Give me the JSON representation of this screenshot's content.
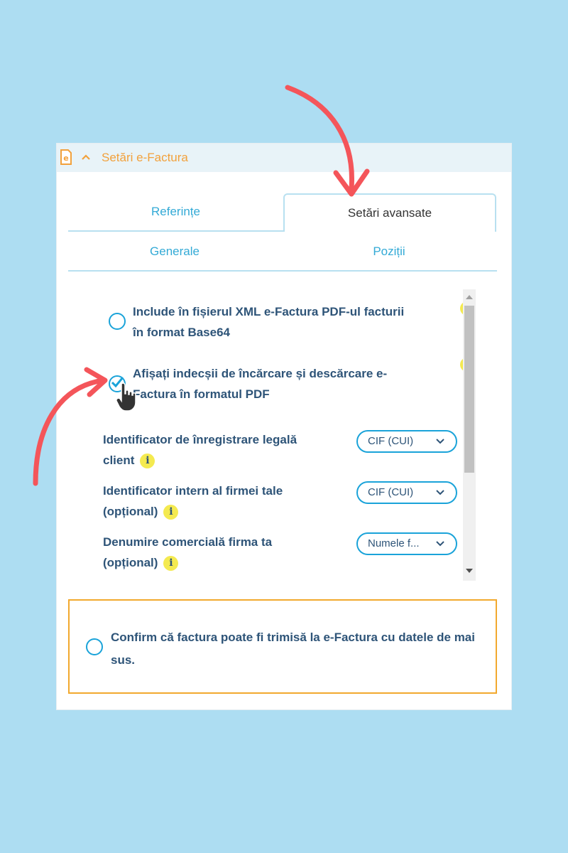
{
  "colors": {
    "background": "#ADDDF2",
    "accent_blue": "#1AA3D9",
    "text_dark_blue": "#2E5478",
    "header_orange": "#F2A13C",
    "confirm_border": "#F2A92E",
    "info_yellow": "#F4EA50",
    "arrow_red": "#F4555A"
  },
  "header": {
    "icon": "document-e-icon",
    "title": "Setări e-Factura"
  },
  "tabs": [
    {
      "label": "Referințe",
      "active": false
    },
    {
      "label": "Setări avansate",
      "active": true
    }
  ],
  "subtabs": [
    {
      "label": "Generale"
    },
    {
      "label": "Poziții"
    }
  ],
  "options": [
    {
      "line1": "Include în fișierul XML e-Factura PDF-ul facturii",
      "line2": "în format Base64",
      "checked": false
    },
    {
      "line1": "Afișați indecșii de încărcare și descărcare e-",
      "line2": "Factura în formatul PDF",
      "checked": true
    }
  ],
  "fields": [
    {
      "line1": "Identificator de înregistrare legală",
      "line2": "client",
      "info": "i",
      "select_value": "CIF (CUI)"
    },
    {
      "line1": "Identificator intern al firmei tale",
      "line2": "(opțional)",
      "info": "i",
      "select_value": "CIF (CUI)"
    },
    {
      "line1": "Denumire comercială firma ta",
      "line2": "(opțional)",
      "info": "i",
      "select_value": "Numele f..."
    }
  ],
  "confirm": {
    "text": "Confirm că factura poate fi trimisă la e-Factura cu datele de mai sus.",
    "checked": false
  }
}
